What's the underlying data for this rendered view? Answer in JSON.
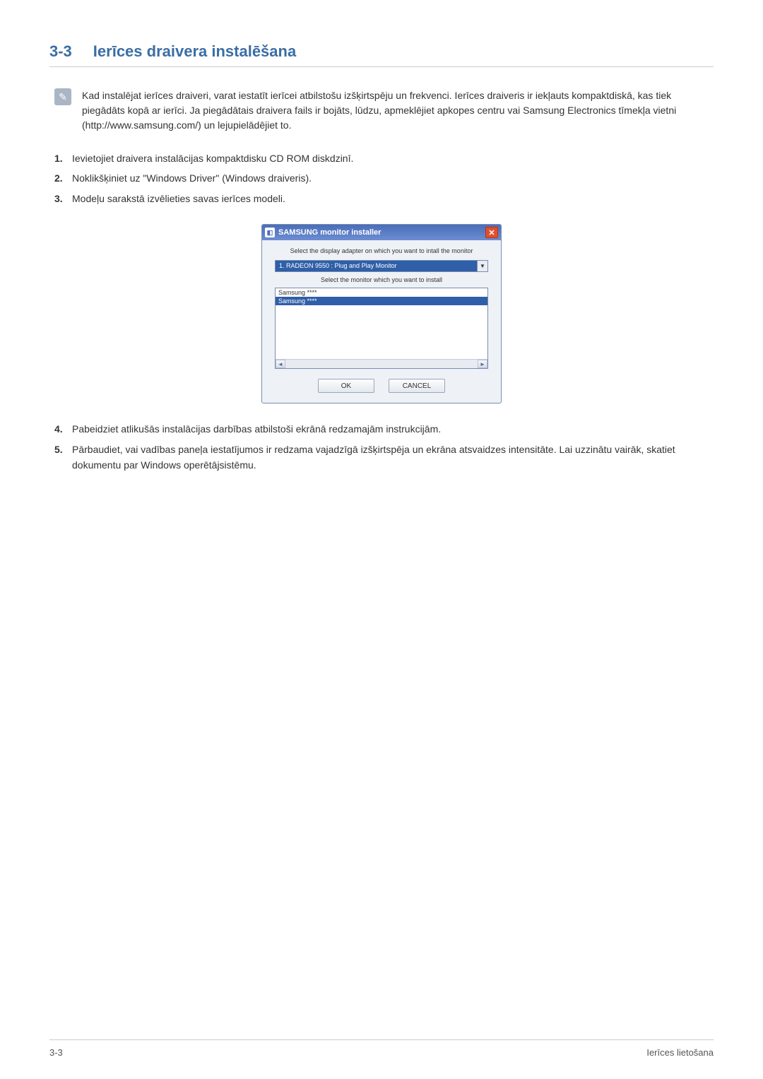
{
  "header": {
    "number": "3-3",
    "title": "Ierīces draivera instalēšana"
  },
  "note": {
    "text": "Kad instalējat ierīces draiveri, varat iestatīt ierīcei atbilstošu izšķirtspēju un frekvenci. Ierīces draiveris ir iekļauts kompaktdiskā, kas tiek piegādāts kopā ar ierīci. Ja piegādātais draivera fails ir bojāts, lūdzu, apmeklējiet apkopes centru vai Samsung Electronics tīmekļa vietni (http://www.samsung.com/) un lejupielādējiet to."
  },
  "steps1": [
    "Ievietojiet draivera instalācijas kompaktdisku CD ROM diskdzinī.",
    "Noklikšķiniet uz \"Windows Driver\" (Windows draiveris).",
    "Modeļu sarakstā izvēlieties savas ierīces modeli."
  ],
  "installer": {
    "title": "SAMSUNG monitor installer",
    "label1": "Select the display adapter on which you want to intall the monitor",
    "dropdown": "1. RADEON 9550 : Plug and Play Monitor",
    "label2": "Select the monitor which you want to install",
    "list": [
      "Samsung ****",
      "Samsung ****"
    ],
    "ok": "OK",
    "cancel": "CANCEL"
  },
  "steps2": [
    "Pabeidziet atlikušās instalācijas darbības atbilstoši ekrānā redzamajām instrukcijām.",
    "Pārbaudiet, vai vadības paneļa iestatījumos ir redzama vajadzīgā izšķirtspēja un ekrāna atsvaidzes intensitāte. Lai uzzinātu vairāk, skatiet dokumentu par Windows operētājsistēmu."
  ],
  "footer": {
    "left": "3-3",
    "right": "Ierīces lietošana"
  }
}
